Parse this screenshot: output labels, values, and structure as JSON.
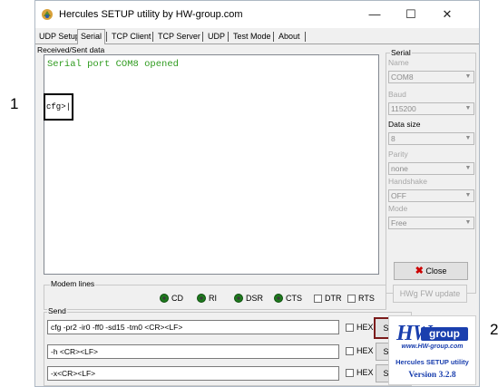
{
  "window": {
    "title": "Hercules SETUP utility by HW-group.com",
    "controls": {
      "minimize": "—",
      "maximize": "☐",
      "close": "✕"
    }
  },
  "tabs": [
    {
      "label": "UDP Setup"
    },
    {
      "label": "Serial",
      "active": true
    },
    {
      "label": "TCP Client"
    },
    {
      "label": "TCP Server"
    },
    {
      "label": "UDP"
    },
    {
      "label": "Test Mode"
    },
    {
      "label": "About"
    }
  ],
  "received": {
    "group_label": "Received/Sent data",
    "lines": [
      "Serial port COM8 opened",
      "cfg>|"
    ]
  },
  "serial": {
    "group_label": "Serial",
    "name_label": "Name",
    "name_value": "COM8",
    "baud_label": "Baud",
    "baud_value": "115200",
    "datasize_label": "Data size",
    "datasize_value": "8",
    "parity_label": "Parity",
    "parity_value": "none",
    "handshake_label": "Handshake",
    "handshake_value": "OFF",
    "mode_label": "Mode",
    "mode_value": "Free",
    "close_label": "Close",
    "fw_label": "HWg FW update"
  },
  "modem": {
    "group_label": "Modem lines",
    "leds": [
      "CD",
      "RI",
      "DSR",
      "CTS"
    ],
    "checks": [
      "DTR",
      "RTS"
    ]
  },
  "send": {
    "group_label": "Send",
    "rows": [
      {
        "value": "cfg -pr2 -ir0 -ff0 -sd15 -tm0 <CR><LF>",
        "hex_label": "HEX",
        "button": "Send"
      },
      {
        "value": "-h <CR><LF>",
        "hex_label": "HEX",
        "button": "Send"
      },
      {
        "value": "-x<CR><LF>",
        "hex_label": "HEX",
        "button": "Send"
      }
    ]
  },
  "logo": {
    "hw": "HW",
    "group": "group",
    "url": "www.HW-group.com",
    "app": "Hercules SETUP utility",
    "version": "Version  3.2.8"
  },
  "annotations": {
    "one": "1",
    "two": "2"
  },
  "colors": {
    "received_text": "#2f9b1f",
    "highlight_box": "#7b1b1b",
    "logo_blue": "#1a3fae"
  }
}
